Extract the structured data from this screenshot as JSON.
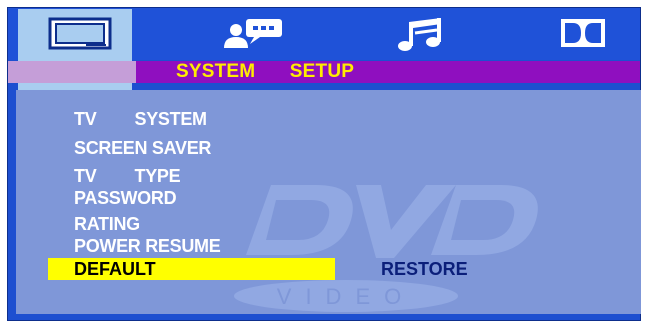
{
  "header": {
    "tabs": [
      {
        "icon": "tv-icon",
        "active": true
      },
      {
        "icon": "people-icon",
        "active": false
      },
      {
        "icon": "music-note-icon",
        "active": false
      },
      {
        "icon": "dolby-icon",
        "active": false
      }
    ],
    "title": "SYSTEM   SETUP"
  },
  "menu": {
    "items": [
      {
        "label": "TV   SYSTEM"
      },
      {
        "label": "SCREEN SAVER"
      },
      {
        "label": "TV   TYPE"
      },
      {
        "label": "PASSWORD"
      },
      {
        "label": "RATING"
      },
      {
        "label": "POWER RESUME"
      },
      {
        "label": "DEFAULT",
        "selected": true
      }
    ],
    "selected_value": "RESTORE"
  },
  "watermark": {
    "logo": "DVD",
    "sub": "VIDEO"
  },
  "colors": {
    "header_bg": "#1f52d8",
    "title_bar": "#8f0fbf",
    "title_text": "#ffec00",
    "panel_bg": "#7f97d8",
    "highlight": "#ffff00",
    "active_tab": "#a9cdf0",
    "value_text": "#0b1f7a"
  }
}
